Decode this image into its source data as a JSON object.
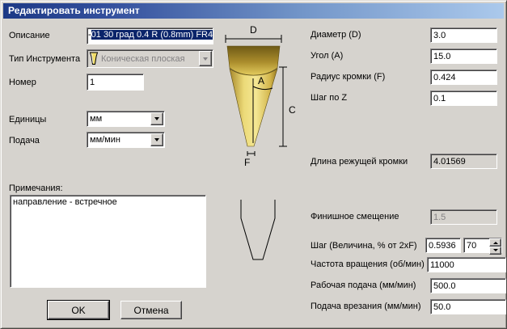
{
  "window": {
    "title": "Редактировать инструмент"
  },
  "colors": {
    "dialog_bg": "#d6d3ce",
    "titlebar_left": "#1c3986",
    "titlebar_right": "#abc9ec",
    "selection_bg": "#0a246a",
    "selection_text": "#ffffff",
    "tool_gold": "#e8d468",
    "disabled_text": "#848284"
  },
  "left": {
    "description": {
      "label": "Описание",
      "prefix": "-",
      "value": "01 30 град 0.4 R (0.8mm) FR4"
    },
    "tool_type": {
      "label": "Тип Инструмента",
      "value": "Коническая плоская",
      "icon": "conical-flat-tool-icon"
    },
    "number": {
      "label": "Номер",
      "value": "1"
    },
    "units": {
      "label": "Единицы",
      "value": "мм"
    },
    "feed_units": {
      "label": "Подача",
      "value": "мм/мин"
    },
    "notes": {
      "label": "Примечания:",
      "value": "направление - встречное"
    }
  },
  "diagram": {
    "d": "D",
    "a": "A",
    "c": "C",
    "f": "F"
  },
  "right": {
    "diameter": {
      "label": "Диаметр (D)",
      "value": "3.0"
    },
    "angle": {
      "label": "Угол (A)",
      "value": "15.0"
    },
    "edge_radius": {
      "label": "Радиус кромки (F)",
      "value": "0.424"
    },
    "z_step": {
      "label": "Шаг по Z",
      "value": "0.1"
    },
    "cutting_edge_length": {
      "label": "Длина режущей кромки",
      "value": "4.01569"
    },
    "finish_offset": {
      "label": "Финишное смещение",
      "value": "1.5"
    },
    "stepover": {
      "label": "Шаг (Величина, % от 2xF)",
      "value": "0.5936",
      "percent": "70"
    },
    "spindle_speed": {
      "label": "Частота вращения (об/мин)",
      "value": "11000"
    },
    "work_feed": {
      "label": "Рабочая подача (мм/мин)",
      "value": "500.0"
    },
    "plunge_feed": {
      "label": "Подача врезания (мм/мин)",
      "value": "50.0"
    }
  },
  "buttons": {
    "ok": "OK",
    "cancel": "Отмена"
  }
}
